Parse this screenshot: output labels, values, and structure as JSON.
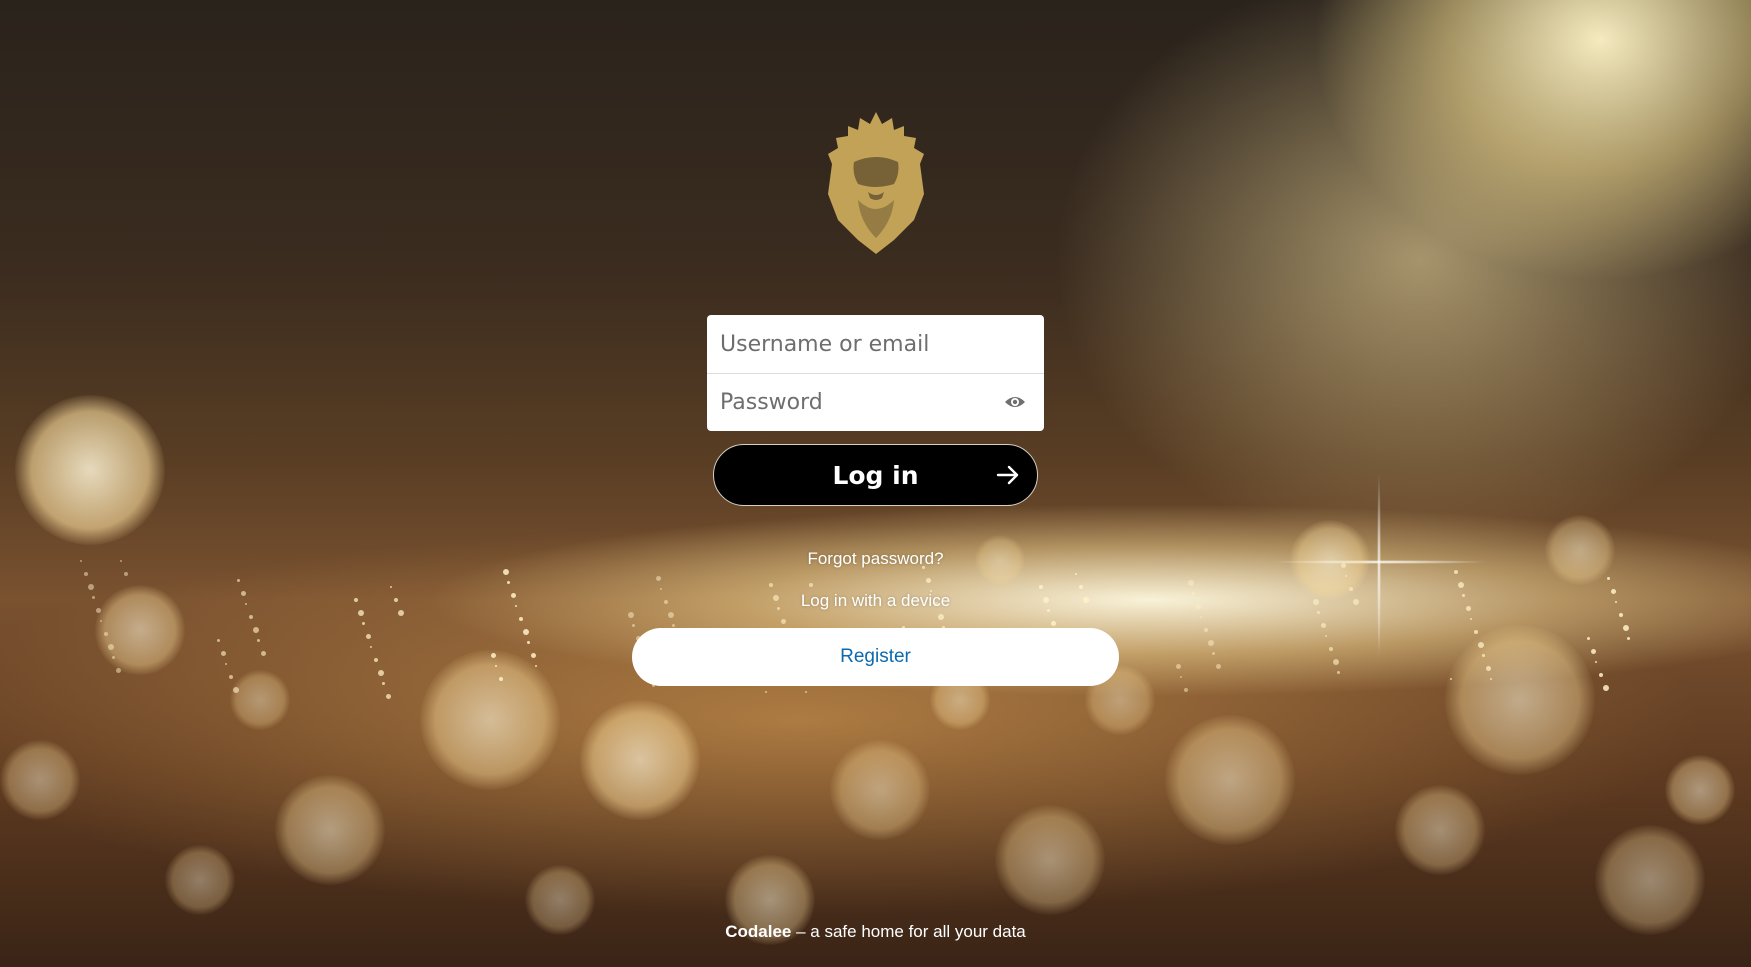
{
  "login": {
    "username_placeholder": "Username or email",
    "password_placeholder": "Password",
    "login_label": "Log in",
    "forgot_label": "Forgot password?",
    "device_label": "Log in with a device",
    "register_label": "Register"
  },
  "footer": {
    "brand": "Codalee",
    "tagline": " – a safe home for all your data"
  },
  "icons": {
    "logo": "lion-crest-logo",
    "eye": "eye-icon",
    "arrow": "arrow-right-icon"
  },
  "colors": {
    "logo_gold": "#c9a95a",
    "login_bg": "#000000",
    "register_text": "#0b6ab0"
  }
}
